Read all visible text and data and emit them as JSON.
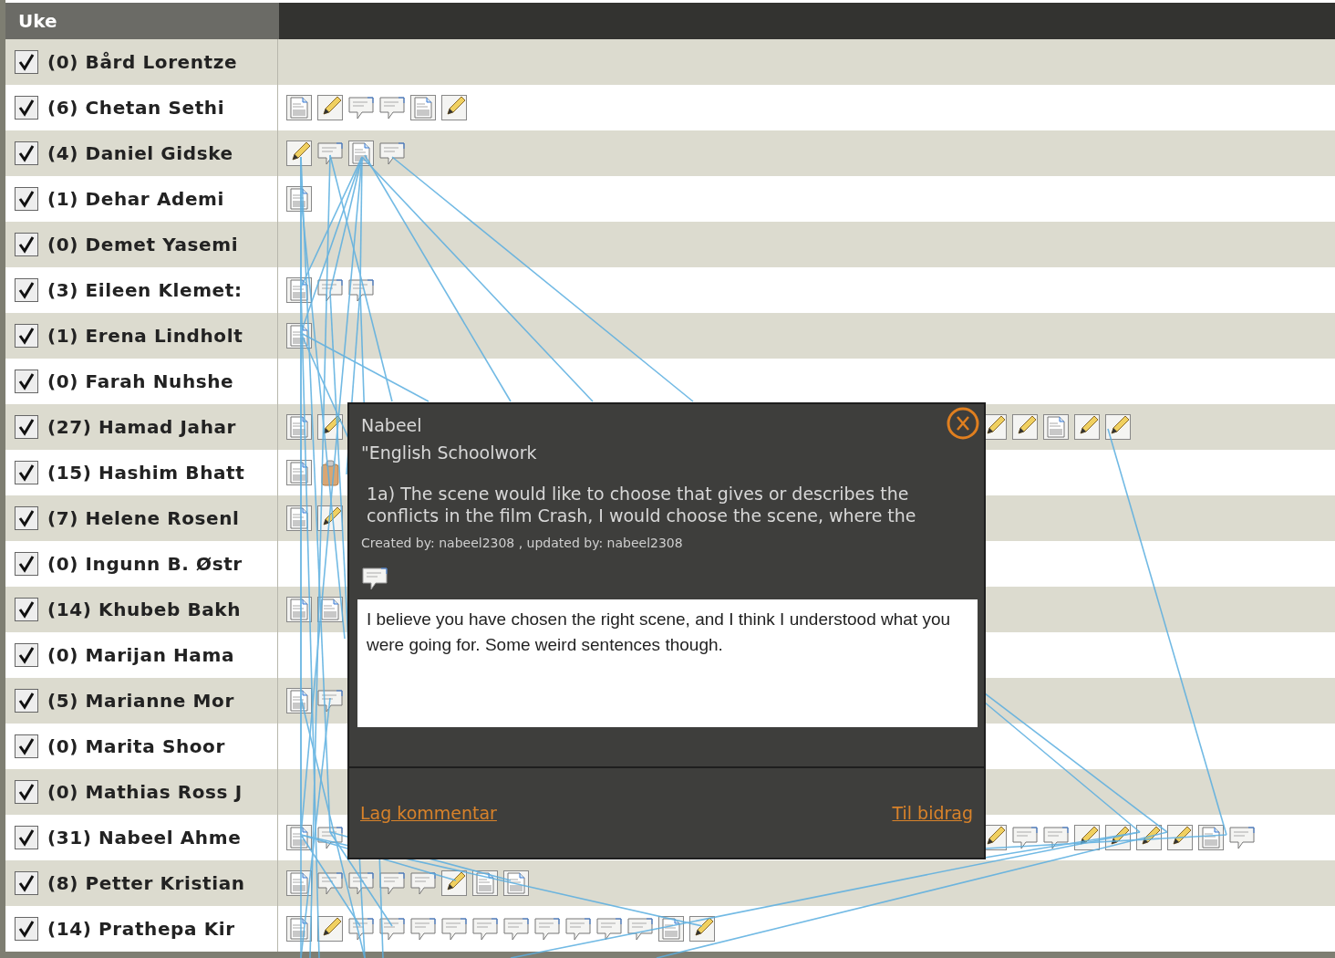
{
  "header": {
    "title": "Uke"
  },
  "rows": [
    {
      "label": "(0) Bård Lorentze",
      "checked": true,
      "icons": []
    },
    {
      "label": "(6) Chetan Sethi",
      "checked": true,
      "icons": [
        {
          "kind": "doc"
        },
        {
          "kind": "pencil"
        },
        {
          "kind": "comment"
        },
        {
          "kind": "comment"
        },
        {
          "kind": "doc"
        },
        {
          "kind": "pencil"
        }
      ]
    },
    {
      "label": "(4) Daniel Gidske",
      "checked": true,
      "icons": [
        {
          "kind": "pencil"
        },
        {
          "kind": "comment"
        },
        {
          "kind": "doc"
        },
        {
          "kind": "comment"
        }
      ]
    },
    {
      "label": "(1) Dehar Ademi",
      "checked": true,
      "icons": [
        {
          "kind": "doc"
        }
      ]
    },
    {
      "label": "(0) Demet Yasemi",
      "checked": true,
      "icons": []
    },
    {
      "label": "(3) Eileen Klemet:",
      "checked": true,
      "icons": [
        {
          "kind": "doc"
        },
        {
          "kind": "comment"
        },
        {
          "kind": "comment"
        }
      ]
    },
    {
      "label": "(1) Erena Lindholt",
      "checked": true,
      "icons": [
        {
          "kind": "doc"
        }
      ]
    },
    {
      "label": "(0) Farah Nuhshe",
      "checked": true,
      "icons": []
    },
    {
      "label": "(27) Hamad Jahar",
      "checked": true,
      "icons": [
        {
          "kind": "doc"
        },
        {
          "kind": "pencil"
        }
      ],
      "icons_after_popup": [
        {
          "kind": "pencil"
        },
        {
          "kind": "pencil"
        },
        {
          "kind": "doc"
        },
        {
          "kind": "pencil"
        },
        {
          "kind": "pencil"
        }
      ]
    },
    {
      "label": "(15) Hashim Bhatt",
      "checked": true,
      "icons": [
        {
          "kind": "doc"
        },
        {
          "kind": "clip"
        }
      ]
    },
    {
      "label": "(7) Helene Rosenl",
      "checked": true,
      "icons": [
        {
          "kind": "doc"
        },
        {
          "kind": "pencil"
        }
      ]
    },
    {
      "label": "(0) Ingunn B. Østr",
      "checked": true,
      "icons": []
    },
    {
      "label": "(14) Khubeb Bakh",
      "checked": true,
      "icons": [
        {
          "kind": "doc"
        },
        {
          "kind": "doc"
        }
      ]
    },
    {
      "label": "(0) Marijan Hama",
      "checked": true,
      "icons": []
    },
    {
      "label": "(5) Marianne Mor",
      "checked": true,
      "icons": [
        {
          "kind": "doc"
        },
        {
          "kind": "comment"
        }
      ]
    },
    {
      "label": "(0) Marita Shoor",
      "checked": true,
      "icons": []
    },
    {
      "label": "(0) Mathias Ross J",
      "checked": true,
      "icons": []
    },
    {
      "label": "(31) Nabeel Ahme",
      "checked": true,
      "icons": [
        {
          "kind": "doc"
        },
        {
          "kind": "comment"
        }
      ],
      "icons_after_popup": [
        {
          "kind": "pencil"
        },
        {
          "kind": "comment"
        },
        {
          "kind": "comment"
        },
        {
          "kind": "pencil"
        },
        {
          "kind": "pencil"
        },
        {
          "kind": "pencil"
        },
        {
          "kind": "pencil"
        },
        {
          "kind": "doc"
        },
        {
          "kind": "comment"
        }
      ]
    },
    {
      "label": "(8) Petter Kristian",
      "checked": true,
      "icons": [
        {
          "kind": "doc"
        },
        {
          "kind": "comment"
        },
        {
          "kind": "comment"
        },
        {
          "kind": "comment"
        },
        {
          "kind": "comment"
        },
        {
          "kind": "pencil"
        },
        {
          "kind": "doc"
        },
        {
          "kind": "doc"
        }
      ]
    },
    {
      "label": "(14) Prathepa Kir",
      "checked": true,
      "icons": [
        {
          "kind": "doc"
        },
        {
          "kind": "pencil"
        },
        {
          "kind": "comment"
        },
        {
          "kind": "comment"
        },
        {
          "kind": "comment"
        },
        {
          "kind": "comment"
        },
        {
          "kind": "comment"
        },
        {
          "kind": "comment"
        },
        {
          "kind": "comment"
        },
        {
          "kind": "comment"
        },
        {
          "kind": "comment"
        },
        {
          "kind": "comment"
        },
        {
          "kind": "doc"
        },
        {
          "kind": "pencil"
        }
      ]
    }
  ],
  "popup": {
    "author": "Nabeel",
    "title": "\"English Schoolwork",
    "excerpt": "1a) The scene would like to choose that gives or describes the conflicts in the film Crash, I would choose the scene, where the",
    "meta": "Created by: nabeel2308 , updated by: nabeel2308",
    "comment": "I believe you have chosen the right scene, and I think I understood what you were going for. Some weird sentences though.",
    "links": [
      "Lag kommentar",
      "Til bidrag"
    ]
  }
}
